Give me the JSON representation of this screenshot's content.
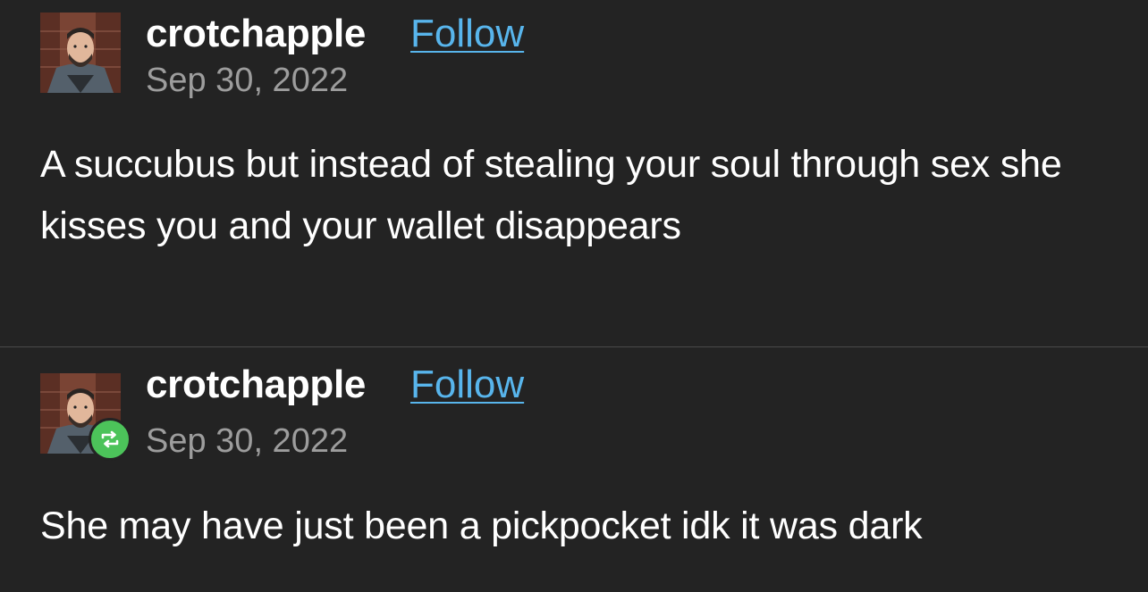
{
  "colors": {
    "background": "#232323",
    "text": "#ffffff",
    "follow_link": "#58b5ec",
    "date": "#9d9d9d",
    "reblog_badge": "#4cc35a",
    "divider": "#4a4a4a"
  },
  "posts": [
    {
      "username": "crotchapple",
      "follow_label": "Follow",
      "date": "Sep 30, 2022",
      "text": "A succubus but instead of stealing your soul through sex she kisses you and your wallet disappears",
      "reblogged": false
    },
    {
      "username": "crotchapple",
      "follow_label": "Follow",
      "date": "Sep 30, 2022",
      "text": "She may have just been a pickpocket idk it was dark",
      "reblogged": true,
      "badge_icon": "reblog-icon"
    }
  ]
}
